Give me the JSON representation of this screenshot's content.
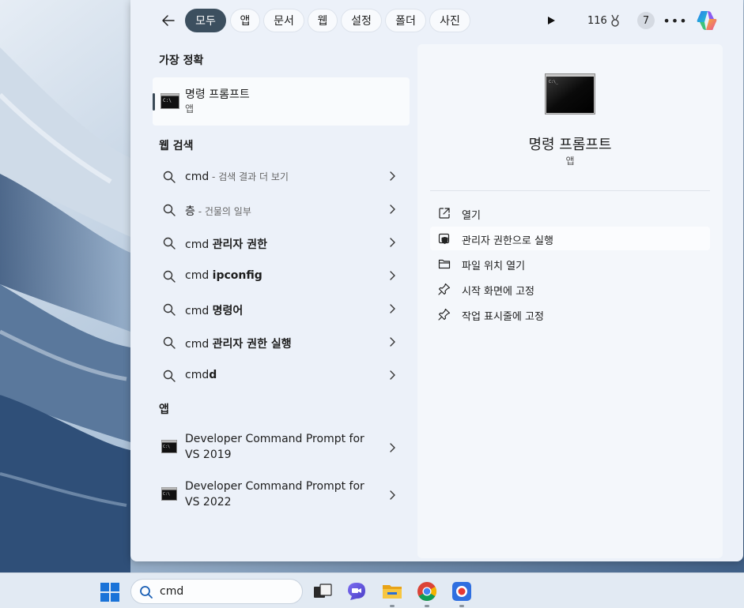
{
  "filters": {
    "tabs": [
      {
        "label": "모두",
        "active": true
      },
      {
        "label": "앱",
        "active": false
      },
      {
        "label": "문서",
        "active": false
      },
      {
        "label": "웹",
        "active": false
      },
      {
        "label": "설정",
        "active": false
      },
      {
        "label": "폴더",
        "active": false
      },
      {
        "label": "사진",
        "active": false
      }
    ],
    "points": "116",
    "badge": "7"
  },
  "best_match": {
    "heading": "가장 정확",
    "title": "명령 프롬프트",
    "subtitle": "앱"
  },
  "web_search": {
    "heading": "웹 검색",
    "items": [
      {
        "query": "cmd",
        "bold": "",
        "note": " - 검색 결과 더 보기"
      },
      {
        "query": "층",
        "bold": "",
        "note": " - 건물의 일부"
      },
      {
        "query": "cmd ",
        "bold": "관리자 권한",
        "note": ""
      },
      {
        "query": "cmd ",
        "bold": "ipconfig",
        "note": ""
      },
      {
        "query": "cmd ",
        "bold": "명령어",
        "note": ""
      },
      {
        "query": "cmd ",
        "bold": "관리자 권한 실행",
        "note": ""
      },
      {
        "query": "cmd",
        "bold": "d",
        "note": ""
      }
    ]
  },
  "apps": {
    "heading": "앱",
    "items": [
      {
        "line1": "Developer Command Prompt for",
        "line2": "VS 2019"
      },
      {
        "line1": "Developer Command Prompt for",
        "line2": "VS 2022"
      }
    ]
  },
  "detail": {
    "title": "명령 프롬프트",
    "subtitle": "앱",
    "actions": [
      {
        "label": "열기",
        "icon": "open-external-icon"
      },
      {
        "label": "관리자 권한으로 실행",
        "icon": "shield-icon"
      },
      {
        "label": "파일 위치 열기",
        "icon": "folder-icon"
      },
      {
        "label": "시작 화면에 고정",
        "icon": "pin-icon"
      },
      {
        "label": "작업 표시줄에 고정",
        "icon": "pin-icon"
      }
    ]
  },
  "taskbar": {
    "search_value": "cmd"
  },
  "colors": {
    "active_chip": "#3c4f5f",
    "panel_bg": "#ecf1f9",
    "detail_bg": "#f4f7fb"
  }
}
